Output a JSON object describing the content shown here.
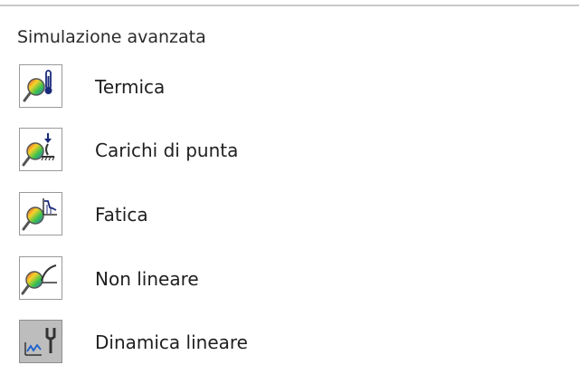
{
  "section": {
    "title": "Simulazione avanzata"
  },
  "items": [
    {
      "label": "Termica",
      "icon": "thermal-study-icon"
    },
    {
      "label": "Carichi di punta",
      "icon": "buckling-study-icon"
    },
    {
      "label": "Fatica",
      "icon": "fatigue-study-icon"
    },
    {
      "label": "Non lineare",
      "icon": "nonlinear-study-icon"
    },
    {
      "label": "Dinamica lineare",
      "icon": "linear-dynamic-study-icon"
    }
  ],
  "colors": {
    "icon_border": "#9a9a9a",
    "icon_shaded_bg": "#bdbdbd",
    "text": "#1f1f1f",
    "rule": "#c9c9c9"
  }
}
